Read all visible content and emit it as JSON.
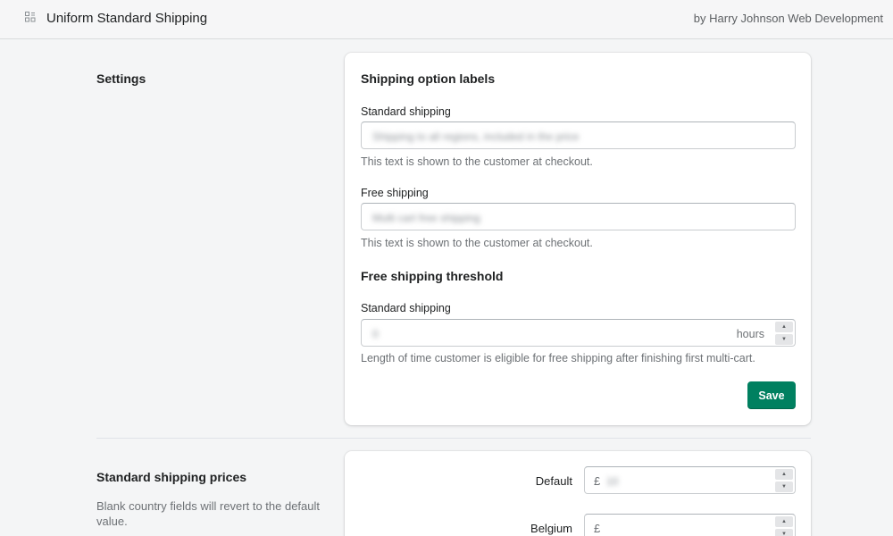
{
  "header": {
    "app_title": "Uniform Standard Shipping",
    "byline": "by Harry Johnson Web Development",
    "app_icon": "apps-grid-icon"
  },
  "settings": {
    "title": "Settings",
    "card": {
      "labels_heading": "Shipping option labels",
      "standard": {
        "label": "Standard shipping",
        "value": "Shipping to all regions, included in the price",
        "help": "This text is shown to the customer at checkout."
      },
      "free": {
        "label": "Free shipping",
        "value": "Multi cart free shipping",
        "help": "This text is shown to the customer at checkout."
      },
      "threshold_heading": "Free shipping threshold",
      "threshold": {
        "label": "Standard shipping",
        "value": "0",
        "suffix": "hours",
        "help": "Length of time customer is eligible for free shipping after finishing first multi-cart."
      },
      "save_label": "Save"
    }
  },
  "prices": {
    "title": "Standard shipping prices",
    "description": "Blank country fields will revert to the default value.",
    "rows": [
      {
        "label": "Default",
        "currency": "£",
        "value": "10"
      },
      {
        "label": "Belgium",
        "currency": "£",
        "value": ""
      }
    ]
  },
  "colors": {
    "primary": "#008060",
    "background": "#f4f5f6",
    "card": "#ffffff"
  }
}
